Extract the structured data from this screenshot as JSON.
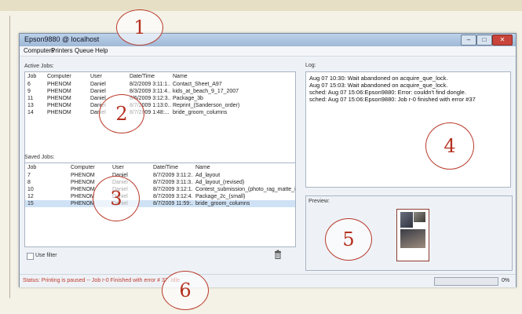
{
  "window": {
    "title": "Epson9880 @ localhost"
  },
  "menu": [
    "Computers",
    "Printers",
    "Queue",
    "Help"
  ],
  "active_jobs": {
    "label": "Active Jobs:",
    "columns": [
      "Job",
      "Computer",
      "User",
      "Date/Time",
      "Name"
    ],
    "rows": [
      [
        "6",
        "PHENOM",
        "Daniel",
        "8/2/2009 3:11:1...",
        "Contact_Sheet_A97"
      ],
      [
        "9",
        "PHENOM",
        "Daniel",
        "8/3/2009 3:11:4...",
        "kids_at_beach_9_17_2007"
      ],
      [
        "11",
        "PHENOM",
        "Daniel",
        "8/6/2009 3:12:3...",
        "Package_3b"
      ],
      [
        "13",
        "PHENOM",
        "Daniel",
        "8/7/2009 1:13:0...",
        "Reprint_(Sanderson_order)"
      ],
      [
        "14",
        "PHENOM",
        "Daniel",
        "8/7/2009 1:48:...",
        "bride_groom_columns"
      ]
    ]
  },
  "saved_jobs": {
    "label": "Saved Jobs:",
    "columns": [
      "Job",
      "Computer",
      "User",
      "Date/Time",
      "Name"
    ],
    "rows": [
      [
        "7",
        "PHENOM",
        "Daniel",
        "8/7/2009 3:11:2...",
        "Ad_layout"
      ],
      [
        "8",
        "PHENOM",
        "Daniel",
        "8/7/2009 3:11:3...",
        "Ad_layout_(revised)"
      ],
      [
        "10",
        "PHENOM",
        "Daniel",
        "8/7/2009 3:12:1...",
        "Contest_submission_(photo_rag_matte_ink)"
      ],
      [
        "12",
        "PHENOM",
        "Daniel",
        "8/7/2009 3:12:4...",
        "Package_2c_(small)"
      ],
      [
        "15",
        "PHENOM",
        "Daniel",
        "8/7/2009 11:59:...",
        "bride_groom_columns"
      ]
    ],
    "selected_index": 4
  },
  "use_filter_label": "Use filter",
  "log": {
    "label": "Log:",
    "lines": [
      "Aug 07 10:30: Wait abandoned on acquire_que_lock.",
      "Aug 07 15:03: Wait abandoned on acquire_que_lock.",
      "sched: Aug 07 15:06:Epson9880: Error: couldn't find dongle.",
      "sched: Aug 07 15:06:Epson9880: Job r-0 finished with error #37"
    ]
  },
  "preview": {
    "label": "Preview:"
  },
  "status": {
    "text": "Status: Printing is paused -- Job r-0 Finished with error # 37: Idle",
    "progress_percent": 0,
    "progress_text": "0%"
  },
  "callouts": [
    "1",
    "2",
    "3",
    "4",
    "5",
    "6"
  ],
  "colors": {
    "callout": "#b5301f",
    "status_text": "#c0392b",
    "selection": "#cfe2f5"
  }
}
